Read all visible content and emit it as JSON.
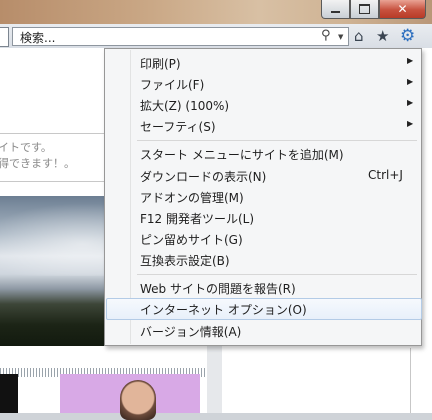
{
  "browser": {
    "search": {
      "placeholder": "検索..."
    },
    "icons": {
      "home": "home-icon",
      "favorites": "star-icon",
      "tools": "gear-icon",
      "search": "search-icon"
    }
  },
  "page": {
    "text_line1": "イトです。",
    "text_line2": "得できます！。"
  },
  "menu": {
    "items": [
      {
        "label": "印刷(P)",
        "submenu": true
      },
      {
        "label": "ファイル(F)",
        "submenu": true
      },
      {
        "label": "拡大(Z) (100%)",
        "submenu": true
      },
      {
        "label": "セーフティ(S)",
        "submenu": true
      },
      {
        "label": "スタート メニューにサイトを追加(M)"
      },
      {
        "label": "ダウンロードの表示(N)",
        "shortcut": "Ctrl+J"
      },
      {
        "label": "アドオンの管理(M)"
      },
      {
        "label": "F12 開発者ツール(L)"
      },
      {
        "label": "ピン留めサイト(G)"
      },
      {
        "label": "互換表示設定(B)"
      },
      {
        "label": "Web サイトの問題を報告(R)"
      },
      {
        "label": "インターネット オプション(O)",
        "highlighted": true
      },
      {
        "label": "バージョン情報(A)"
      }
    ]
  },
  "colors": {
    "menu_highlight_border": "#b3cbe6",
    "close_button": "#c7513e",
    "tools_icon": "#2d6fbf"
  }
}
